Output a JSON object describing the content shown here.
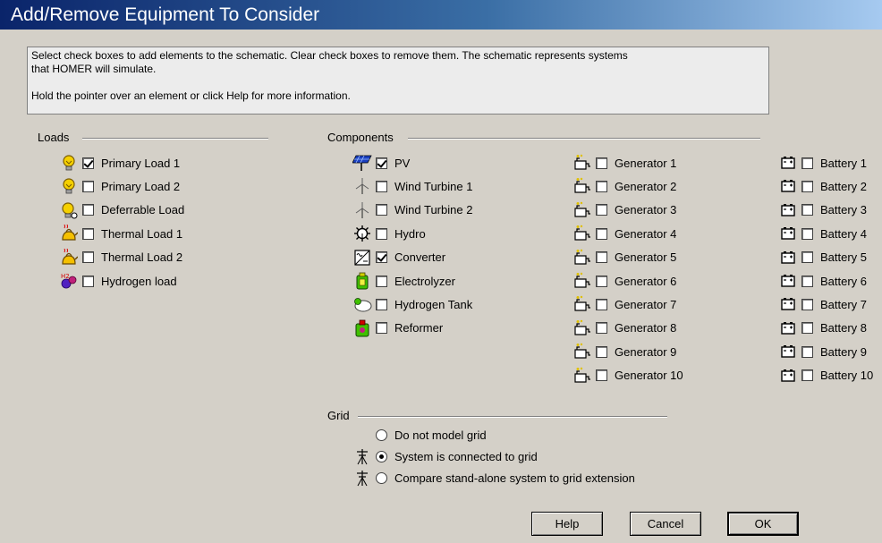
{
  "window": {
    "title": "Add/Remove Equipment To Consider"
  },
  "info": {
    "line1": "Select check boxes to add elements to the schematic. Clear check boxes to remove them. The schematic represents systems",
    "line2": "that HOMER will simulate.",
    "line3": "Hold the pointer over an element or click Help for more information."
  },
  "loads": {
    "label": "Loads",
    "items": [
      {
        "label": "Primary Load 1",
        "checked": true,
        "icon": "bulb-icon"
      },
      {
        "label": "Primary Load 2",
        "checked": false,
        "icon": "bulb-icon"
      },
      {
        "label": "Deferrable Load",
        "checked": false,
        "icon": "deferrable-bulb-icon"
      },
      {
        "label": "Thermal Load 1",
        "checked": false,
        "icon": "kettle-icon"
      },
      {
        "label": "Thermal Load 2",
        "checked": false,
        "icon": "kettle-icon"
      },
      {
        "label": "Hydrogen load",
        "checked": false,
        "icon": "hydrogen-molecule-icon"
      }
    ]
  },
  "components": {
    "label": "Components",
    "items": [
      {
        "label": "PV",
        "checked": true,
        "icon": "solar-panel-icon"
      },
      {
        "label": "Wind Turbine 1",
        "checked": false,
        "icon": "wind-turbine-icon"
      },
      {
        "label": "Wind Turbine 2",
        "checked": false,
        "icon": "wind-turbine-icon"
      },
      {
        "label": "Hydro",
        "checked": false,
        "icon": "hydro-wheel-icon"
      },
      {
        "label": "Converter",
        "checked": true,
        "icon": "converter-icon"
      },
      {
        "label": "Electrolyzer",
        "checked": false,
        "icon": "electrolyzer-icon"
      },
      {
        "label": "Hydrogen Tank",
        "checked": false,
        "icon": "hydrogen-tank-icon"
      },
      {
        "label": "Reformer",
        "checked": false,
        "icon": "reformer-icon"
      }
    ],
    "generators": [
      {
        "label": "Generator 1",
        "checked": false
      },
      {
        "label": "Generator 2",
        "checked": false
      },
      {
        "label": "Generator 3",
        "checked": false
      },
      {
        "label": "Generator 4",
        "checked": false
      },
      {
        "label": "Generator 5",
        "checked": false
      },
      {
        "label": "Generator 6",
        "checked": false
      },
      {
        "label": "Generator 7",
        "checked": false
      },
      {
        "label": "Generator 8",
        "checked": false
      },
      {
        "label": "Generator 9",
        "checked": false
      },
      {
        "label": "Generator 10",
        "checked": false
      }
    ],
    "batteries": [
      {
        "label": "Battery 1",
        "checked": false
      },
      {
        "label": "Battery 2",
        "checked": false
      },
      {
        "label": "Battery 3",
        "checked": false
      },
      {
        "label": "Battery 4",
        "checked": false
      },
      {
        "label": "Battery 5",
        "checked": false
      },
      {
        "label": "Battery 6",
        "checked": false
      },
      {
        "label": "Battery 7",
        "checked": false
      },
      {
        "label": "Battery 8",
        "checked": false
      },
      {
        "label": "Battery 9",
        "checked": false
      },
      {
        "label": "Battery 10",
        "checked": false
      }
    ]
  },
  "grid": {
    "label": "Grid",
    "options": [
      {
        "label": "Do not model grid",
        "checked": false,
        "icon": ""
      },
      {
        "label": "System is connected to grid",
        "checked": true,
        "icon": "grid-tower-icon"
      },
      {
        "label": "Compare stand-alone system to grid extension",
        "checked": false,
        "icon": "grid-tower-icon"
      }
    ]
  },
  "buttons": {
    "help": "Help",
    "cancel": "Cancel",
    "ok": "OK"
  },
  "colors": {
    "title_start": "#0a246a",
    "title_end": "#a6caf0",
    "dialog_bg": "#d4d0c8"
  }
}
